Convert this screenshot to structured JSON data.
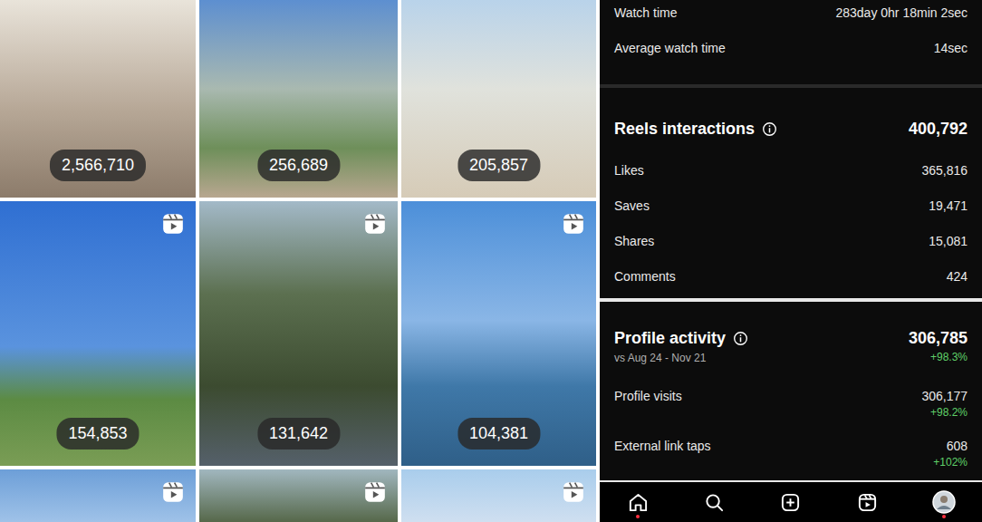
{
  "grid": {
    "tiles": [
      {
        "views": "2,566,710",
        "reel": false
      },
      {
        "views": "256,689",
        "reel": false
      },
      {
        "views": "205,857",
        "reel": false
      },
      {
        "views": "154,853",
        "reel": true
      },
      {
        "views": "131,642",
        "reel": true
      },
      {
        "views": "104,381",
        "reel": true
      },
      {
        "views": "",
        "reel": true
      },
      {
        "views": "",
        "reel": true
      },
      {
        "views": "",
        "reel": true
      }
    ]
  },
  "insights": {
    "watch": [
      {
        "label": "Watch time",
        "value": "283day 0hr 18min 2sec"
      },
      {
        "label": "Average watch time",
        "value": "14sec"
      }
    ],
    "interactions": {
      "title": "Reels interactions",
      "value": "400,792",
      "rows": [
        {
          "label": "Likes",
          "value": "365,816"
        },
        {
          "label": "Saves",
          "value": "19,471"
        },
        {
          "label": "Shares",
          "value": "15,081"
        },
        {
          "label": "Comments",
          "value": "424"
        }
      ]
    },
    "profile_activity": {
      "title": "Profile activity",
      "subtitle": "vs Aug 24 - Nov 21",
      "value": "306,785",
      "change": "+98.3%",
      "rows": [
        {
          "label": "Profile visits",
          "value": "306,177",
          "change": "+98.2%"
        },
        {
          "label": "External link taps",
          "value": "608",
          "change": "+102%"
        }
      ]
    }
  },
  "nav": [
    {
      "kind": "home",
      "dot": true
    },
    {
      "kind": "search",
      "dot": false
    },
    {
      "kind": "create",
      "dot": false
    },
    {
      "kind": "reels",
      "dot": false
    },
    {
      "kind": "profile",
      "dot": true
    }
  ]
}
